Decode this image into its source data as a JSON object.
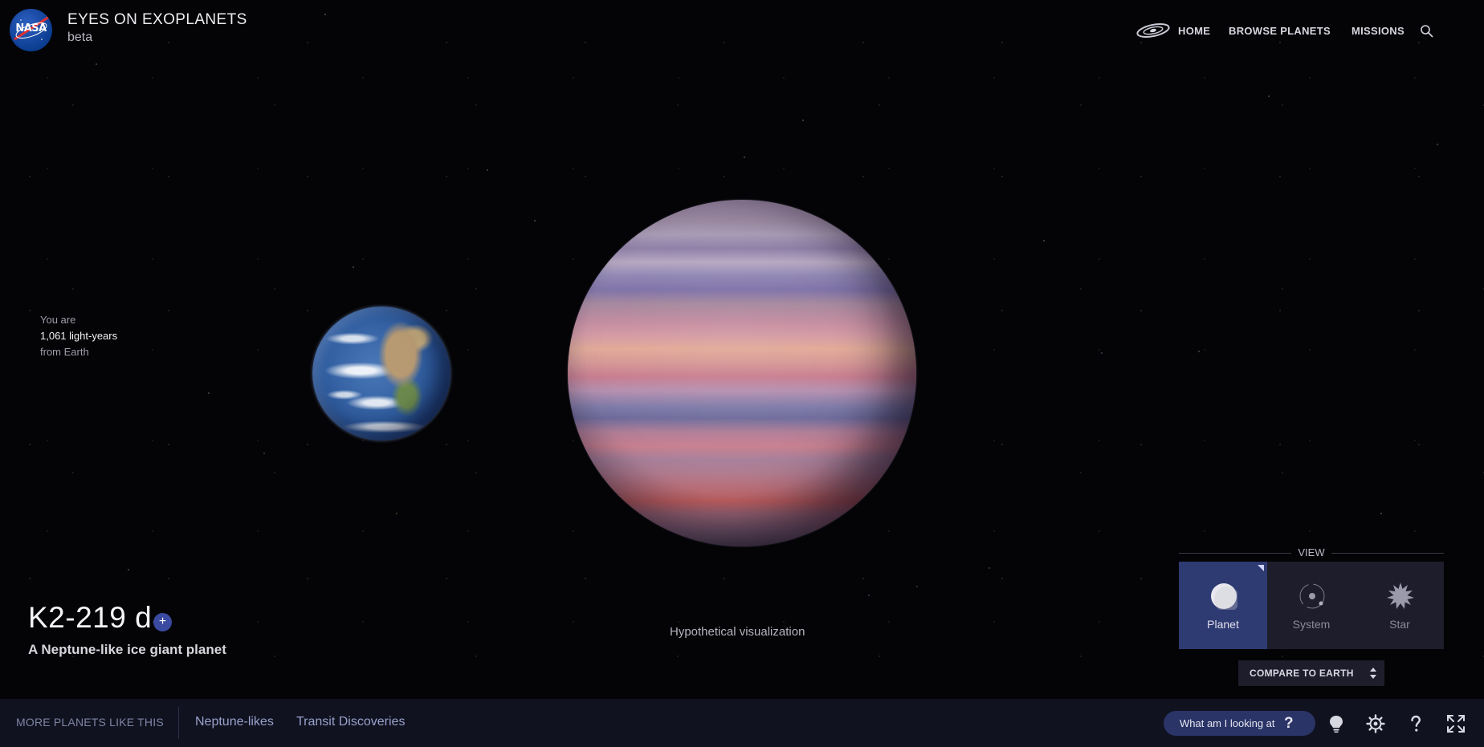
{
  "header": {
    "logo_text": "NASA",
    "title": "EYES ON EXOPLANETS",
    "subtitle": "beta",
    "nav": [
      "HOME",
      "BROWSE PLANETS",
      "MISSIONS"
    ],
    "icons": {
      "home": "galaxy-icon",
      "search": "search-icon"
    }
  },
  "distance": {
    "prefix": "You are",
    "value": "1,061 light-years",
    "suffix": "from Earth"
  },
  "planet": {
    "name": "K2-219 d",
    "add_symbol": "+",
    "description": "A Neptune-like ice giant planet",
    "visual_note": "Hypothetical visualization"
  },
  "view": {
    "label": "VIEW",
    "options": [
      "Planet",
      "System",
      "Star"
    ],
    "selected": "Planet"
  },
  "compare_label": "COMPARE TO EARTH",
  "bottom_bar": {
    "more_label": "MORE PLANETS LIKE THIS",
    "links": [
      "Neptune-likes",
      "Transit Discoveries"
    ],
    "help_label": "What am I looking at",
    "help_symbol": "?",
    "icons": [
      "lightbulb-icon",
      "gear-icon",
      "help-icon",
      "fullscreen-icon"
    ]
  },
  "colors": {
    "accent": "#2e3a72",
    "panel": "#1d1d2c",
    "bar": "#101220",
    "pill": "#2a3466",
    "link": "#9aa2cc"
  }
}
